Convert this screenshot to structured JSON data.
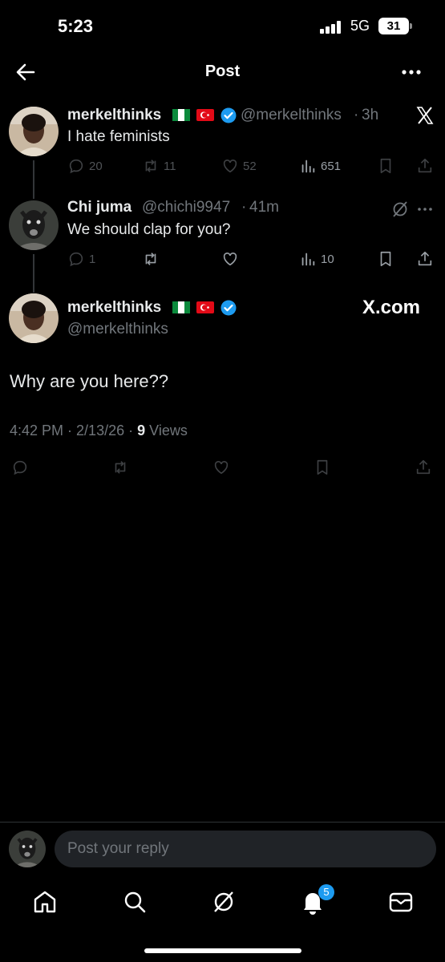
{
  "status_bar": {
    "time": "5:23",
    "network": "5G",
    "battery": "31"
  },
  "header": {
    "title": "Post"
  },
  "post_1": {
    "name": "merkelthinks",
    "handle": "@merkelthinks",
    "separator": "·",
    "time": "3h",
    "text": "I hate feminists",
    "replies": "20",
    "reposts": "11",
    "likes": "52",
    "views": "651"
  },
  "post_2": {
    "name": "Chi juma",
    "handle": "@chichi9947",
    "separator": "·",
    "time": "41m",
    "text": "We should clap for you?",
    "replies": "1",
    "views": "10"
  },
  "main_post": {
    "name": "merkelthinks",
    "handle": "@merkelthinks",
    "text": "Why are you here??",
    "time": "4:42 PM",
    "date": "2/13/26",
    "views_count": "9",
    "views_label": "Views",
    "watermark": "X.com"
  },
  "reply_bar": {
    "placeholder": "Post your reply"
  },
  "nav": {
    "notifications_badge": "5"
  },
  "colors": {
    "background": "#000000",
    "accent": "#1d9bf0",
    "muted": "#71767b",
    "text": "#e7e9ea"
  },
  "icons": [
    "back-arrow-icon",
    "more-dots-icon",
    "x-logo-icon",
    "verified-icon",
    "reply-icon",
    "repost-icon",
    "like-icon",
    "views-icon",
    "bookmark-icon",
    "share-icon",
    "grok-icon",
    "home-icon",
    "search-icon",
    "bell-icon",
    "mail-icon"
  ]
}
